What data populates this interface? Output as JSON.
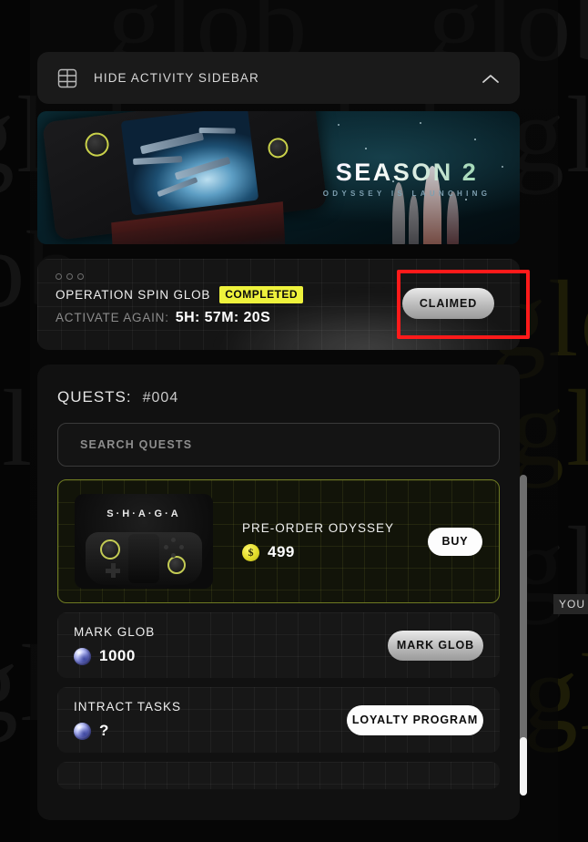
{
  "header": {
    "title": "HIDE ACTIVITY SIDEBAR",
    "grid_icon": "grid-icon",
    "collapse_icon": "chevron-up-icon"
  },
  "banner": {
    "title": "SEASON 2",
    "subtitle": "ODYSSEY IS LAUNCHING"
  },
  "operation": {
    "title": "OPERATION SPIN GLOB",
    "status_badge": "COMPLETED",
    "timer_label": "ACTIVATE AGAIN:",
    "timer_value": "5H: 57M: 20S",
    "action_label": "CLAIMED",
    "badge_color": "#eef23c",
    "annotation_color": "#fe1a1a"
  },
  "quests": {
    "label": "QUESTS:",
    "count": "#004",
    "search_placeholder": "SEARCH QUESTS",
    "search_value": "",
    "items": [
      {
        "title": "PRE-ORDER ODYSSEY",
        "value": "499",
        "currency_icon": "dollar-coin-icon",
        "action_label": "BUY",
        "thumbnail_text": "S·H·A·G·A"
      },
      {
        "title": "MARK GLOB",
        "value": "1000",
        "currency_icon": "glob-token-icon",
        "action_label": "MARK GLOB"
      },
      {
        "title": "INTRACT TASKS",
        "value": "?",
        "currency_icon": "glob-token-icon",
        "action_label": "LOYALTY PROGRAM"
      }
    ]
  },
  "overlay": {
    "you_tag": "YOU"
  },
  "watermark": {
    "text": "glob"
  }
}
